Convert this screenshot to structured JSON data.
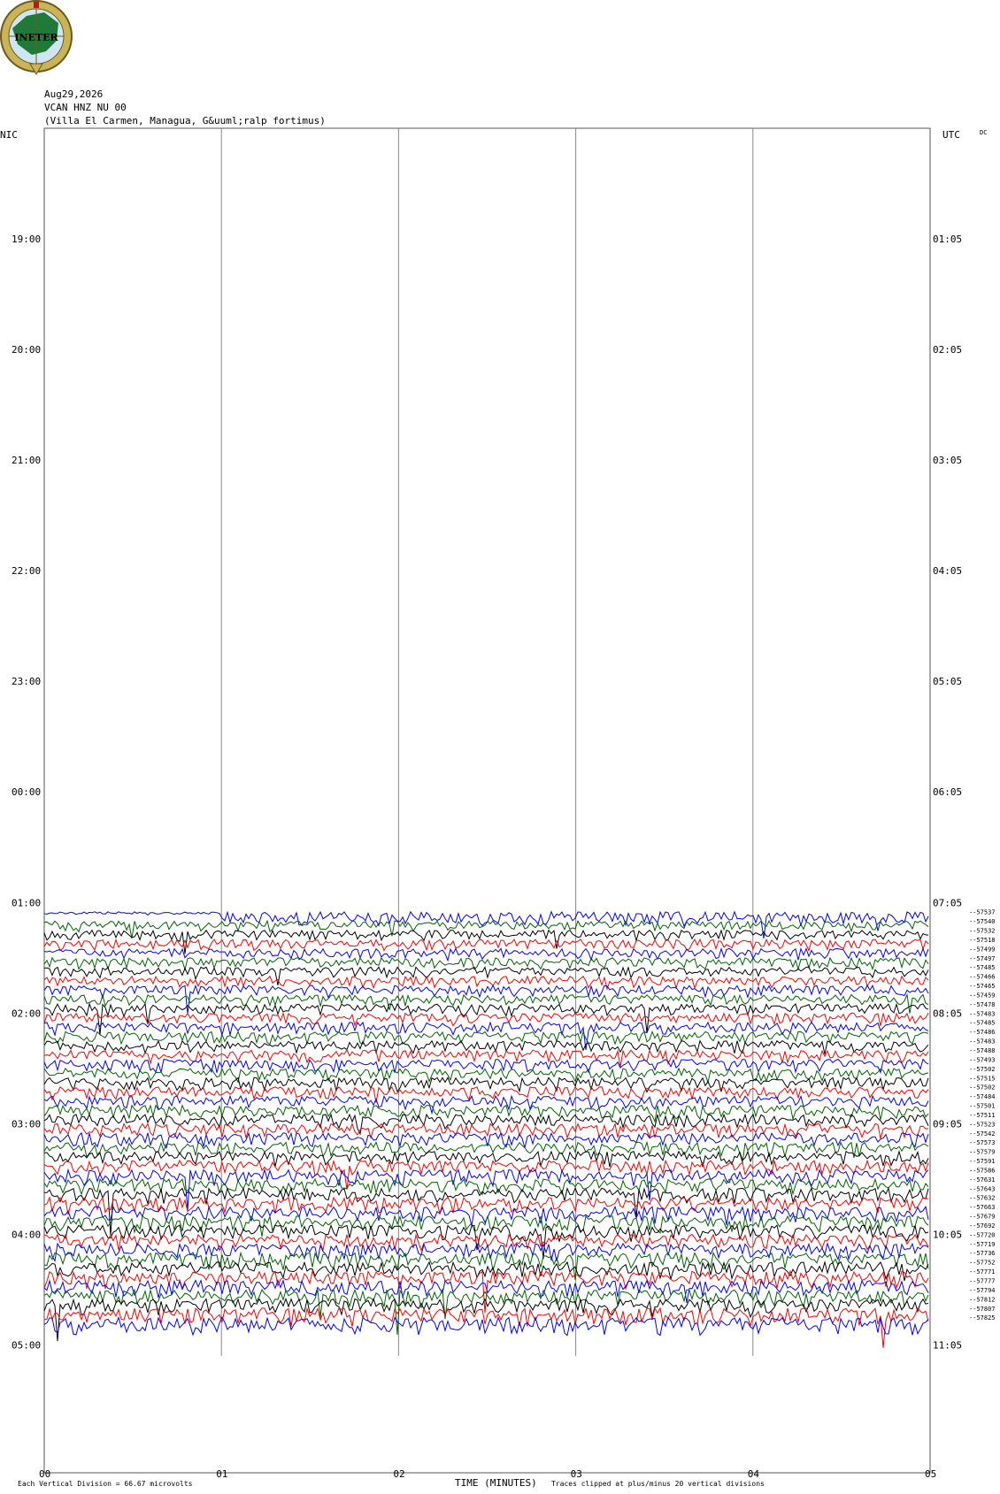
{
  "header": {
    "date": "Aug29,2026",
    "station": "VCAN HNZ NU 00",
    "location": "(Villa El Carmen, Managua, G&uuml;ralp fortimus)",
    "logo_text": "INETER"
  },
  "left_axis_label": "NIC",
  "right_axis_label": "UTC",
  "dc_label": "DC",
  "footer": {
    "scale_note": "Each Vertical Division =   66.67 microvolts",
    "xlabel": "TIME (MINUTES)",
    "clip_note": "Traces clipped at plus/minus 20 vertical divisions"
  },
  "colors": {
    "trace_cycle": [
      "#0000ff",
      "#006400",
      "#000000",
      "#ff0000"
    ],
    "grid": "#888888"
  },
  "chart_data": {
    "type": "line",
    "title": "",
    "xlabel": "TIME (MINUTES)",
    "ylabel": "",
    "x_ticks": [
      "00",
      "01",
      "02",
      "03",
      "04",
      "05"
    ],
    "xlim": [
      0,
      5
    ],
    "left_time_ticks": [
      "19:00",
      "20:00",
      "21:00",
      "22:00",
      "23:00",
      "00:00",
      "01:00",
      "02:00",
      "03:00",
      "04:00",
      "05:00"
    ],
    "right_time_ticks": [
      "01:05",
      "02:05",
      "03:05",
      "04:05",
      "05:05",
      "06:05",
      "07:05",
      "08:05",
      "09:05",
      "10:05",
      "11:05"
    ],
    "rows_per_hour": 12,
    "first_data_row": 85,
    "total_rows": 133,
    "trace_dc_offsets": [
      -57537,
      -57540,
      -57532,
      -57518,
      -57499,
      -57497,
      -57485,
      -57466,
      -57465,
      -57459,
      -57478,
      -57483,
      -57485,
      -57486,
      -57483,
      -57488,
      -57493,
      -57502,
      -57515,
      -57502,
      -57484,
      -57501,
      -57511,
      -57523,
      -57542,
      -57573,
      -57579,
      -57591,
      -57586,
      -57631,
      -57643,
      -57632,
      -57663,
      -57679,
      -57692,
      -57720,
      -57719,
      -57736,
      -57752,
      -57771,
      -57777,
      -57794,
      -57812,
      -57807,
      -57825
    ],
    "grid": true
  }
}
